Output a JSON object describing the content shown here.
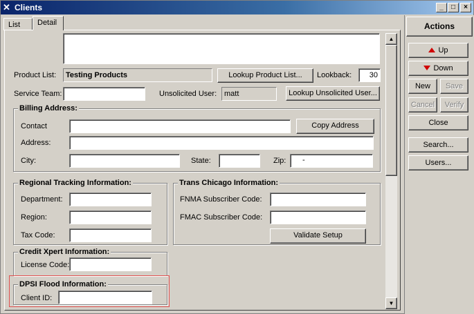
{
  "window": {
    "title": "Clients"
  },
  "tabs": [
    {
      "label": "List"
    },
    {
      "label": "Detail"
    }
  ],
  "form": {
    "product_list": {
      "label": "Product List:",
      "value": "Testing Products"
    },
    "lookup_product_btn": "Lookup Product List...",
    "lookback": {
      "label": "Lookback:",
      "value": "30"
    },
    "service_team": {
      "label": "Service Team:",
      "value": ""
    },
    "unsolicited_user": {
      "label": "Unsolicited User:",
      "value": "matt"
    },
    "lookup_unsolicited_btn": "Lookup Unsolicited User...",
    "billing": {
      "title": "Billing Address:",
      "contact_label": "Contact",
      "copy_address_btn": "Copy Address",
      "address_label": "Address:",
      "city_label": "City:",
      "state_label": "State:",
      "zip_label": "Zip:",
      "zip_value": "-"
    },
    "regional": {
      "title": "Regional Tracking Information:",
      "department_label": "Department:",
      "region_label": "Region:",
      "tax_code_label": "Tax Code:"
    },
    "trans_chicago": {
      "title": "Trans Chicago Information:",
      "fnma_label": "FNMA Subscriber Code:",
      "fmac_label": "FMAC Subscriber Code:",
      "validate_btn": "Validate Setup"
    },
    "credit_xpert": {
      "title": "Credit Xpert Information:",
      "license_label": "License Code:"
    },
    "dpsi": {
      "title": "DPSI Flood Information:",
      "client_id_label": "Client ID:"
    }
  },
  "actions": {
    "title": "Actions",
    "up": "Up",
    "down": "Down",
    "new": "New",
    "save": "Save",
    "cancel": "Cancel",
    "verify": "Verify",
    "close": "Close",
    "search": "Search...",
    "users": "Users..."
  },
  "colors": {
    "highlight_box": "#e05050",
    "arrow": "#d00000",
    "title_bar": "#0a246a"
  }
}
